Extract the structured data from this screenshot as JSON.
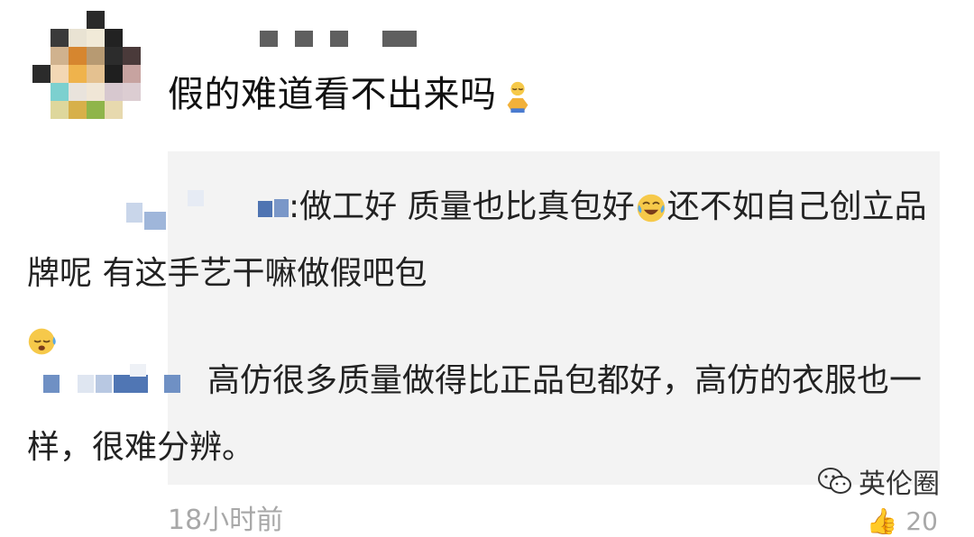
{
  "comment": {
    "username_masked": true,
    "text": "假的难道看不出来吗",
    "emoji": "shrug-person-emoji"
  },
  "replies": [
    {
      "author_masked": true,
      "separator": ":",
      "text_line1": "做工好 质量也比真包好",
      "emoji_mid": "crying-laughing-emoji",
      "text_rest": "还不如自己创立品牌呢 有这手艺干嘛做假吧包",
      "emoji_end": "sweat-emoji"
    },
    {
      "author_masked": true,
      "text": "高仿很多质量做得比正品包都好，高仿的衣服也一样，很难分辨。"
    }
  ],
  "timestamp": "18小时前",
  "watermark": {
    "text": "英伦圈",
    "icon": "wechat-icon"
  },
  "like": {
    "icon": "thumb-up-icon",
    "count": "20"
  },
  "colors": {
    "reply_background": "#f3f3f3",
    "mask_blue": "#5b7fb2",
    "timestamp_grey": "#a8a8a8"
  }
}
